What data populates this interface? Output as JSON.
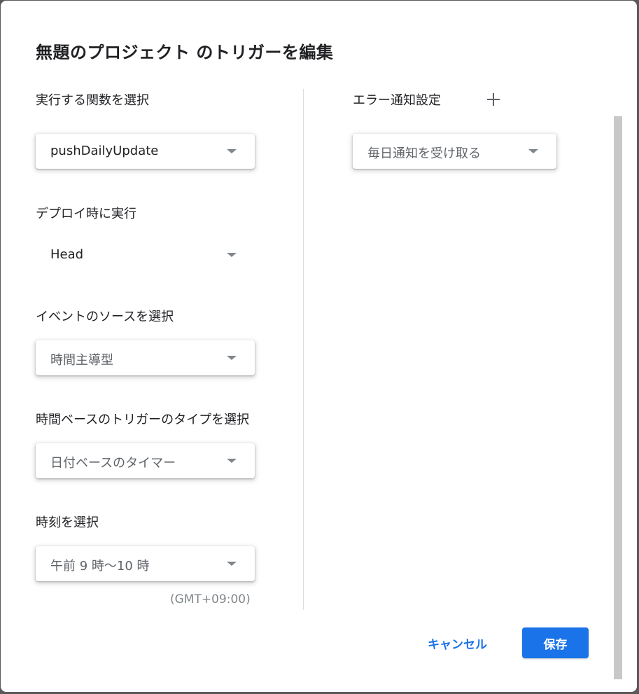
{
  "dialog": {
    "title": "無題のプロジェクト のトリガーを編集"
  },
  "left": {
    "function": {
      "label": "実行する関数を選択",
      "value": "pushDailyUpdate"
    },
    "deployment": {
      "label": "デプロイ時に実行",
      "value": "Head"
    },
    "event_source": {
      "label": "イベントのソースを選択",
      "value": "時間主導型"
    },
    "trigger_type": {
      "label": "時間ベースのトリガーのタイプを選択",
      "value": "日付ベースのタイマー"
    },
    "time_of_day": {
      "label": "時刻を選択",
      "value": "午前 9 時〜10 時",
      "timezone": "(GMT+09:00)"
    }
  },
  "right": {
    "error_notification": {
      "label": "エラー通知設定",
      "add_icon": "plus-icon",
      "value": "毎日通知を受け取る"
    }
  },
  "actions": {
    "cancel_label": "キャンセル",
    "save_label": "保存"
  },
  "colors": {
    "primary": "#1a73e8",
    "text": "#202124",
    "muted": "#5f6368",
    "divider": "#dadce0"
  }
}
